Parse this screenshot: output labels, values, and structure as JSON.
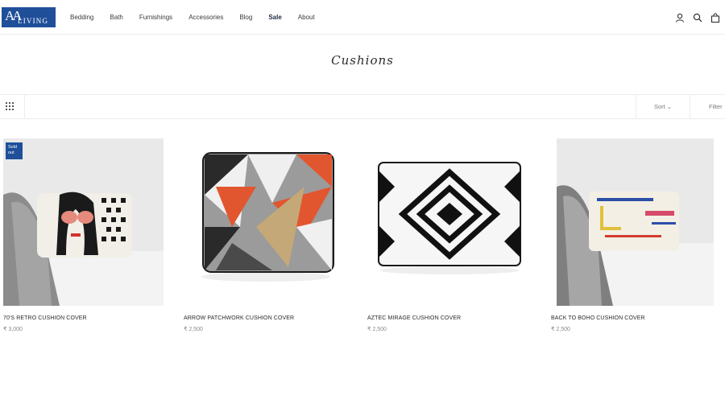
{
  "brand": {
    "monogram": "AA",
    "word": "LIVING"
  },
  "nav": [
    "Bedding",
    "Bath",
    "Furnishings",
    "Accessories",
    "Blog",
    "Sale",
    "About"
  ],
  "page_title": "Cushions",
  "toolbar": {
    "sort": "Sort",
    "filter": "Filter"
  },
  "products": [
    {
      "name": "70'S RETRO CUSHION COVER",
      "price": "₹ 3,000",
      "badge": "Sold out"
    },
    {
      "name": "ARROW PATCHWORK CUSHION COVER",
      "price": "₹ 2,500"
    },
    {
      "name": "AZTEC MIRAGE CUSHION COVER",
      "price": "₹ 2,500"
    },
    {
      "name": "BACK TO BOHO CUSHION COVER",
      "price": "₹ 2,500"
    }
  ],
  "colors": {
    "brand": "#1f4f99",
    "text": "#1f1f1f",
    "muted": "#8a8a8a"
  }
}
